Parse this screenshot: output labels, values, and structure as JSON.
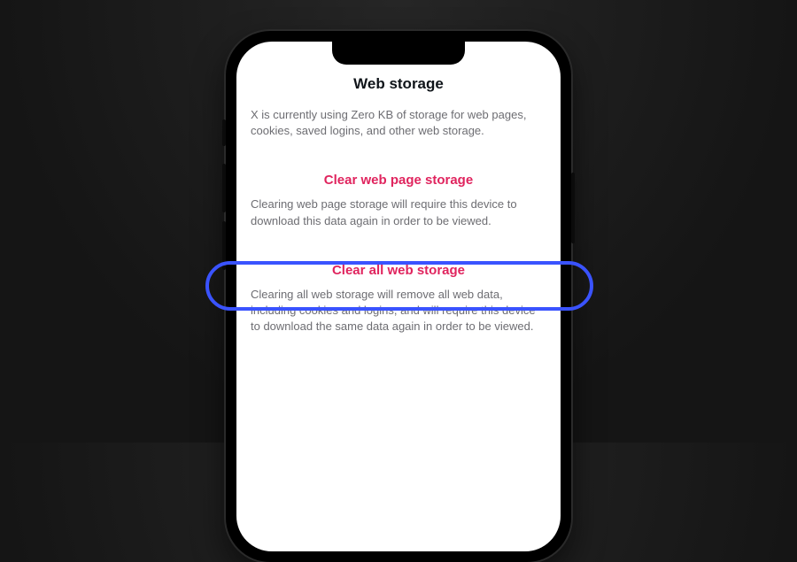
{
  "header": {
    "title": "Web storage"
  },
  "usage": {
    "text": "X is currently using Zero KB of storage for web pages, cookies, saved logins, and other web storage."
  },
  "clear_page": {
    "button_label": "Clear web page storage",
    "description": "Clearing web page storage will require this device to download this data again in order to be viewed."
  },
  "clear_all": {
    "button_label": "Clear all web storage",
    "description": "Clearing all web storage will remove all web data, including cookies and logins, and will require this device to download the same data again in order to be viewed."
  },
  "annotation": {
    "highlight_color": "#3a53ff",
    "danger_color": "#e0245e"
  }
}
